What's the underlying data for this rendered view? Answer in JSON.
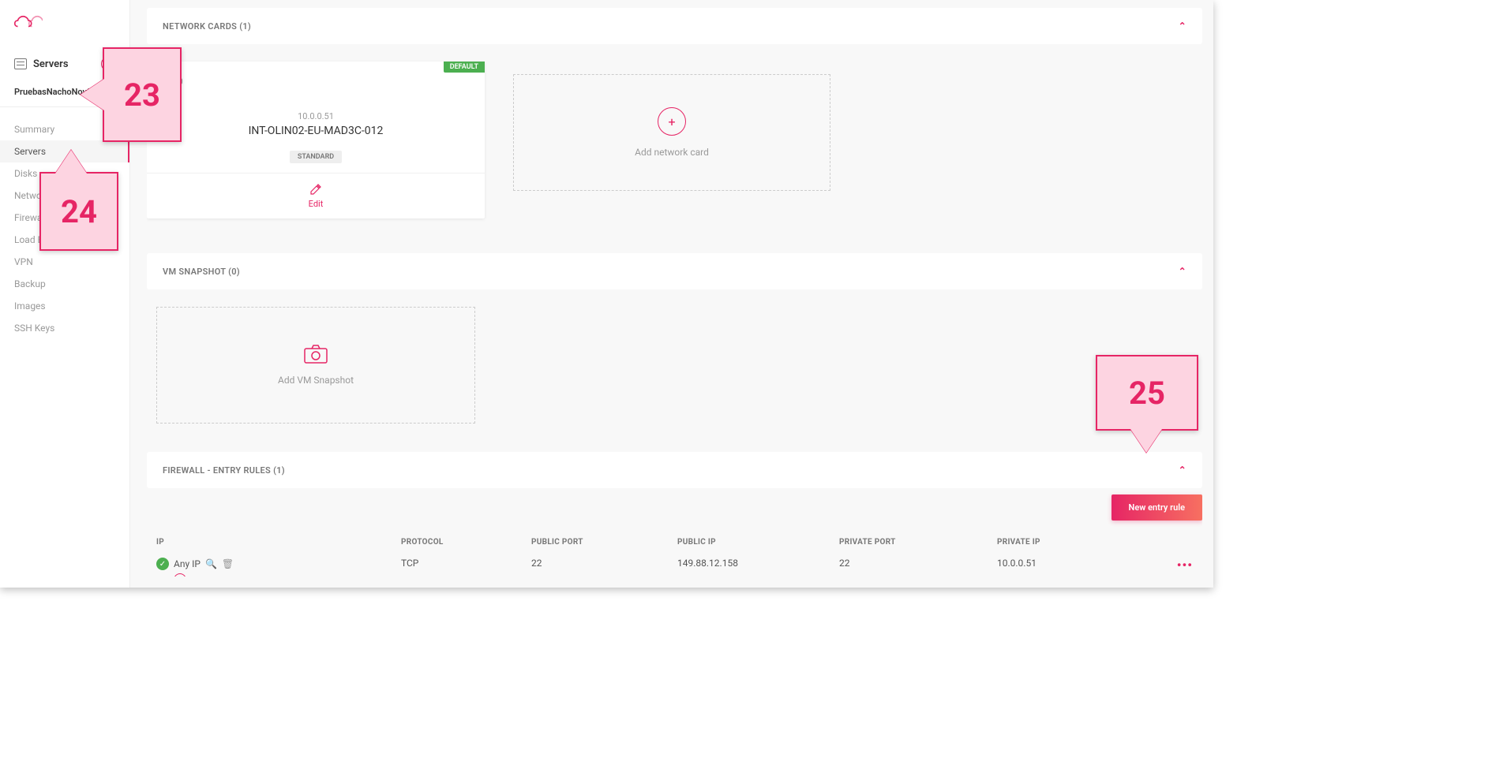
{
  "sidebar": {
    "title": "Servers",
    "project": "PruebasNachoNov2024",
    "items": [
      {
        "label": "Summary"
      },
      {
        "label": "Servers"
      },
      {
        "label": "Disks"
      },
      {
        "label": "Networks/IPs"
      },
      {
        "label": "Firewall"
      },
      {
        "label": "Load Balancers"
      },
      {
        "label": "VPN"
      },
      {
        "label": "Backup"
      },
      {
        "label": "Images"
      },
      {
        "label": "SSH Keys"
      }
    ]
  },
  "network": {
    "header": "NETWORK CARDS (1)",
    "eth": "ETH 0",
    "badge": "DEFAULT",
    "ip": "10.0.0.51",
    "name": "INT-OLIN02-EU-MAD3C-012",
    "tag": "STANDARD",
    "edit": "Edit",
    "add": "Add network card"
  },
  "snapshot": {
    "header": "VM SNAPSHOT (0)",
    "add": "Add VM Snapshot"
  },
  "firewall": {
    "header": "FIREWALL - ENTRY RULES (1)",
    "newrule": "New entry rule",
    "cols": {
      "ip": "IP",
      "proto": "PROTOCOL",
      "pubport": "PUBLIC PORT",
      "pubip": "PUBLIC IP",
      "privport": "PRIVATE PORT",
      "privip": "PRIVATE IP"
    },
    "row": {
      "ip": "Any IP",
      "proto": "TCP",
      "pubport": "22",
      "pubip": "149.88.12.158",
      "privport": "22",
      "privip": "10.0.0.51"
    }
  },
  "annotations": {
    "a": "23",
    "b": "24",
    "c": "25"
  }
}
